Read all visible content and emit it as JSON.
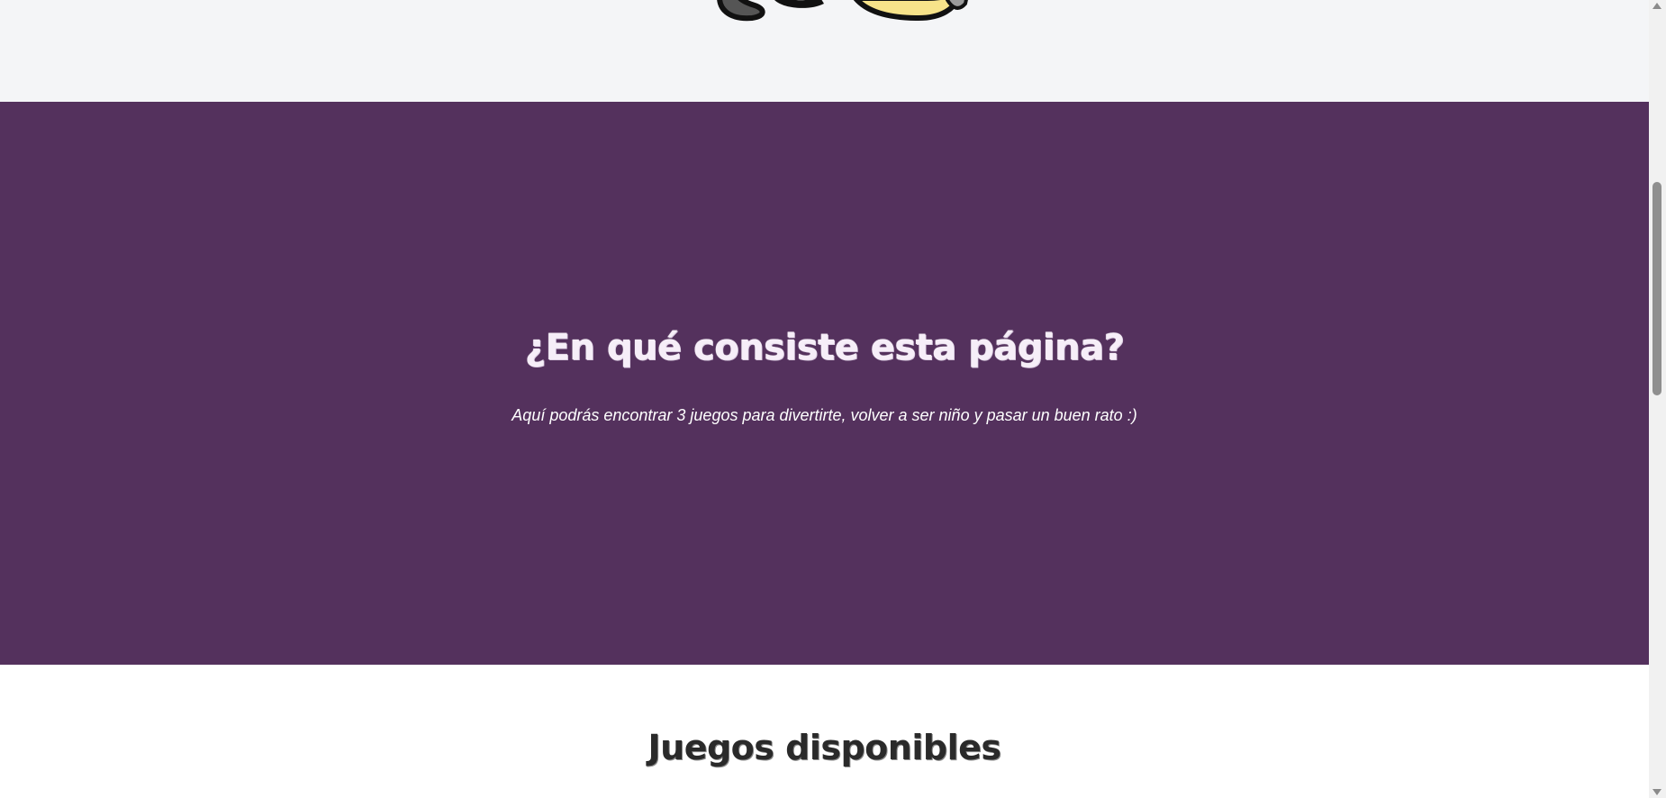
{
  "about": {
    "title": "¿En qué consiste esta página?",
    "description": "Aquí podrás encontrar 3 juegos para divertirte, volver a ser niño y pasar un buen rato :)",
    "background_color": "#54315d"
  },
  "games": {
    "title": "Juegos disponibles"
  },
  "hero": {
    "background_color": "#f4f5f7",
    "illustration_icon": "cartoon-character-illustration"
  }
}
